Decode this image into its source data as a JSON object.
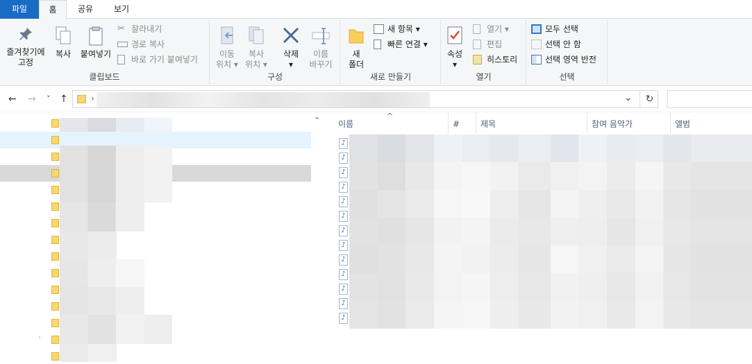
{
  "tabs": [
    "파일",
    "홈",
    "공유",
    "보기"
  ],
  "ribbon": {
    "clipboard": {
      "pin": "즐겨찾기에\n고정",
      "copy": "복사",
      "paste": "붙여넣기",
      "cut": "잘라내기",
      "copy_path": "경로 복사",
      "paste_shortcut": "바로 가기 붙여넣기",
      "label": "클립보드"
    },
    "organize": {
      "move_to": "이동\n위치 ▾",
      "copy_to": "복사\n위치 ▾",
      "delete": "삭제\n▾",
      "rename": "이름\n바꾸기",
      "label": "구성"
    },
    "new": {
      "new_folder": "새\n폴더",
      "new_item": "새 항목 ▾",
      "easy_access": "빠른 연결 ▾",
      "label": "새로 만들기"
    },
    "open": {
      "properties": "속성\n▾",
      "open": "열기 ▾",
      "edit": "편집",
      "history": "히스토리",
      "label": "열기"
    },
    "select": {
      "select_all": "모두 선택",
      "select_none": "선택 안 함",
      "invert": "선택 영역 반전",
      "label": "선택"
    }
  },
  "nav": {
    "back": "←",
    "forward": "→",
    "recent": "˅",
    "up": "↑",
    "refresh": "↻",
    "dropdown": "⌄",
    "sep": "›"
  },
  "columns": {
    "name": "이름",
    "number": "#",
    "title": "제목",
    "artist": "참여 음악가",
    "album": "앨범",
    "sort_arrow": "^"
  },
  "left_scroll_up": "⌃",
  "accent": "#1a6bc4"
}
